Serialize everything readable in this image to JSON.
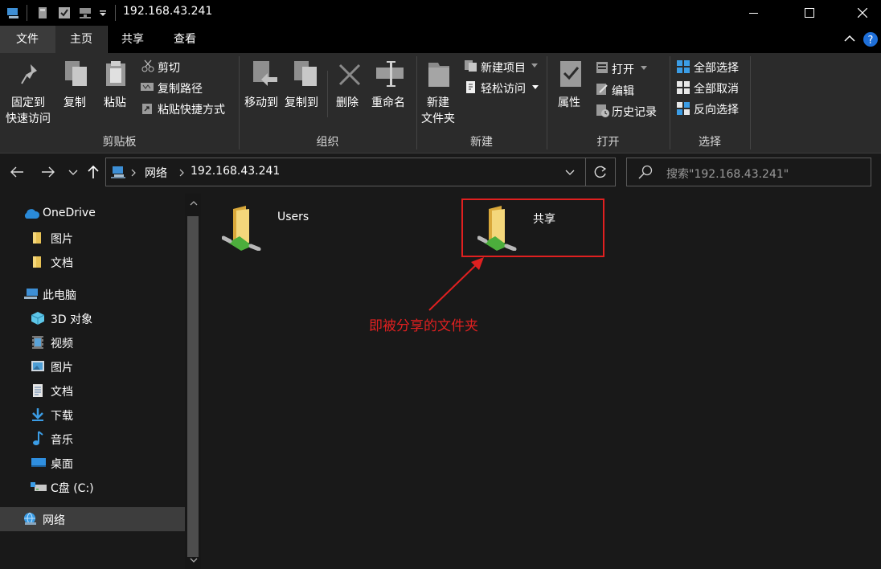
{
  "window": {
    "title": "192.168.43.241",
    "buttons": [
      "minimize",
      "maximize",
      "close"
    ]
  },
  "quick_access": [
    "computer-icon",
    "pin-icon",
    "check-icon",
    "network-drive-icon",
    "customize-dropdown"
  ],
  "tabs": {
    "file": "文件",
    "home": "主页",
    "share": "共享",
    "view": "查看"
  },
  "ribbon": {
    "clipboard": {
      "pin_line1": "固定到",
      "pin_line2": "快速访问",
      "copy": "复制",
      "paste": "粘贴",
      "cut": "剪切",
      "copy_path": "复制路径",
      "paste_shortcut": "粘贴快捷方式",
      "group": "剪贴板"
    },
    "organize": {
      "move_to": "移动到",
      "copy_to": "复制到",
      "delete": "删除",
      "rename": "重命名",
      "group": "组织"
    },
    "new": {
      "new_folder_line1": "新建",
      "new_folder_line2": "文件夹",
      "new_item": "新建项目",
      "easy_access": "轻松访问",
      "group": "新建"
    },
    "open": {
      "properties": "属性",
      "open": "打开",
      "edit": "编辑",
      "history": "历史记录",
      "group": "打开"
    },
    "select": {
      "select_all": "全部选择",
      "select_none": "全部取消",
      "invert": "反向选择",
      "group": "选择"
    }
  },
  "address": {
    "crumb_network": "网络",
    "crumb_host": "192.168.43.241",
    "search_placeholder": "搜索\"192.168.43.241\""
  },
  "nav": {
    "onedrive": "OneDrive",
    "od_pictures": "图片",
    "od_docs": "文档",
    "this_pc": "此电脑",
    "objects3d": "3D 对象",
    "videos": "视频",
    "pictures": "图片",
    "documents": "文档",
    "downloads": "下载",
    "music": "音乐",
    "desktop": "桌面",
    "cdrive": "C盘 (C:)",
    "network": "网络"
  },
  "files": [
    {
      "name": "Users"
    },
    {
      "name": "共享"
    }
  ],
  "annotation": {
    "text": "即被分享的文件夹",
    "color": "#e02020"
  }
}
